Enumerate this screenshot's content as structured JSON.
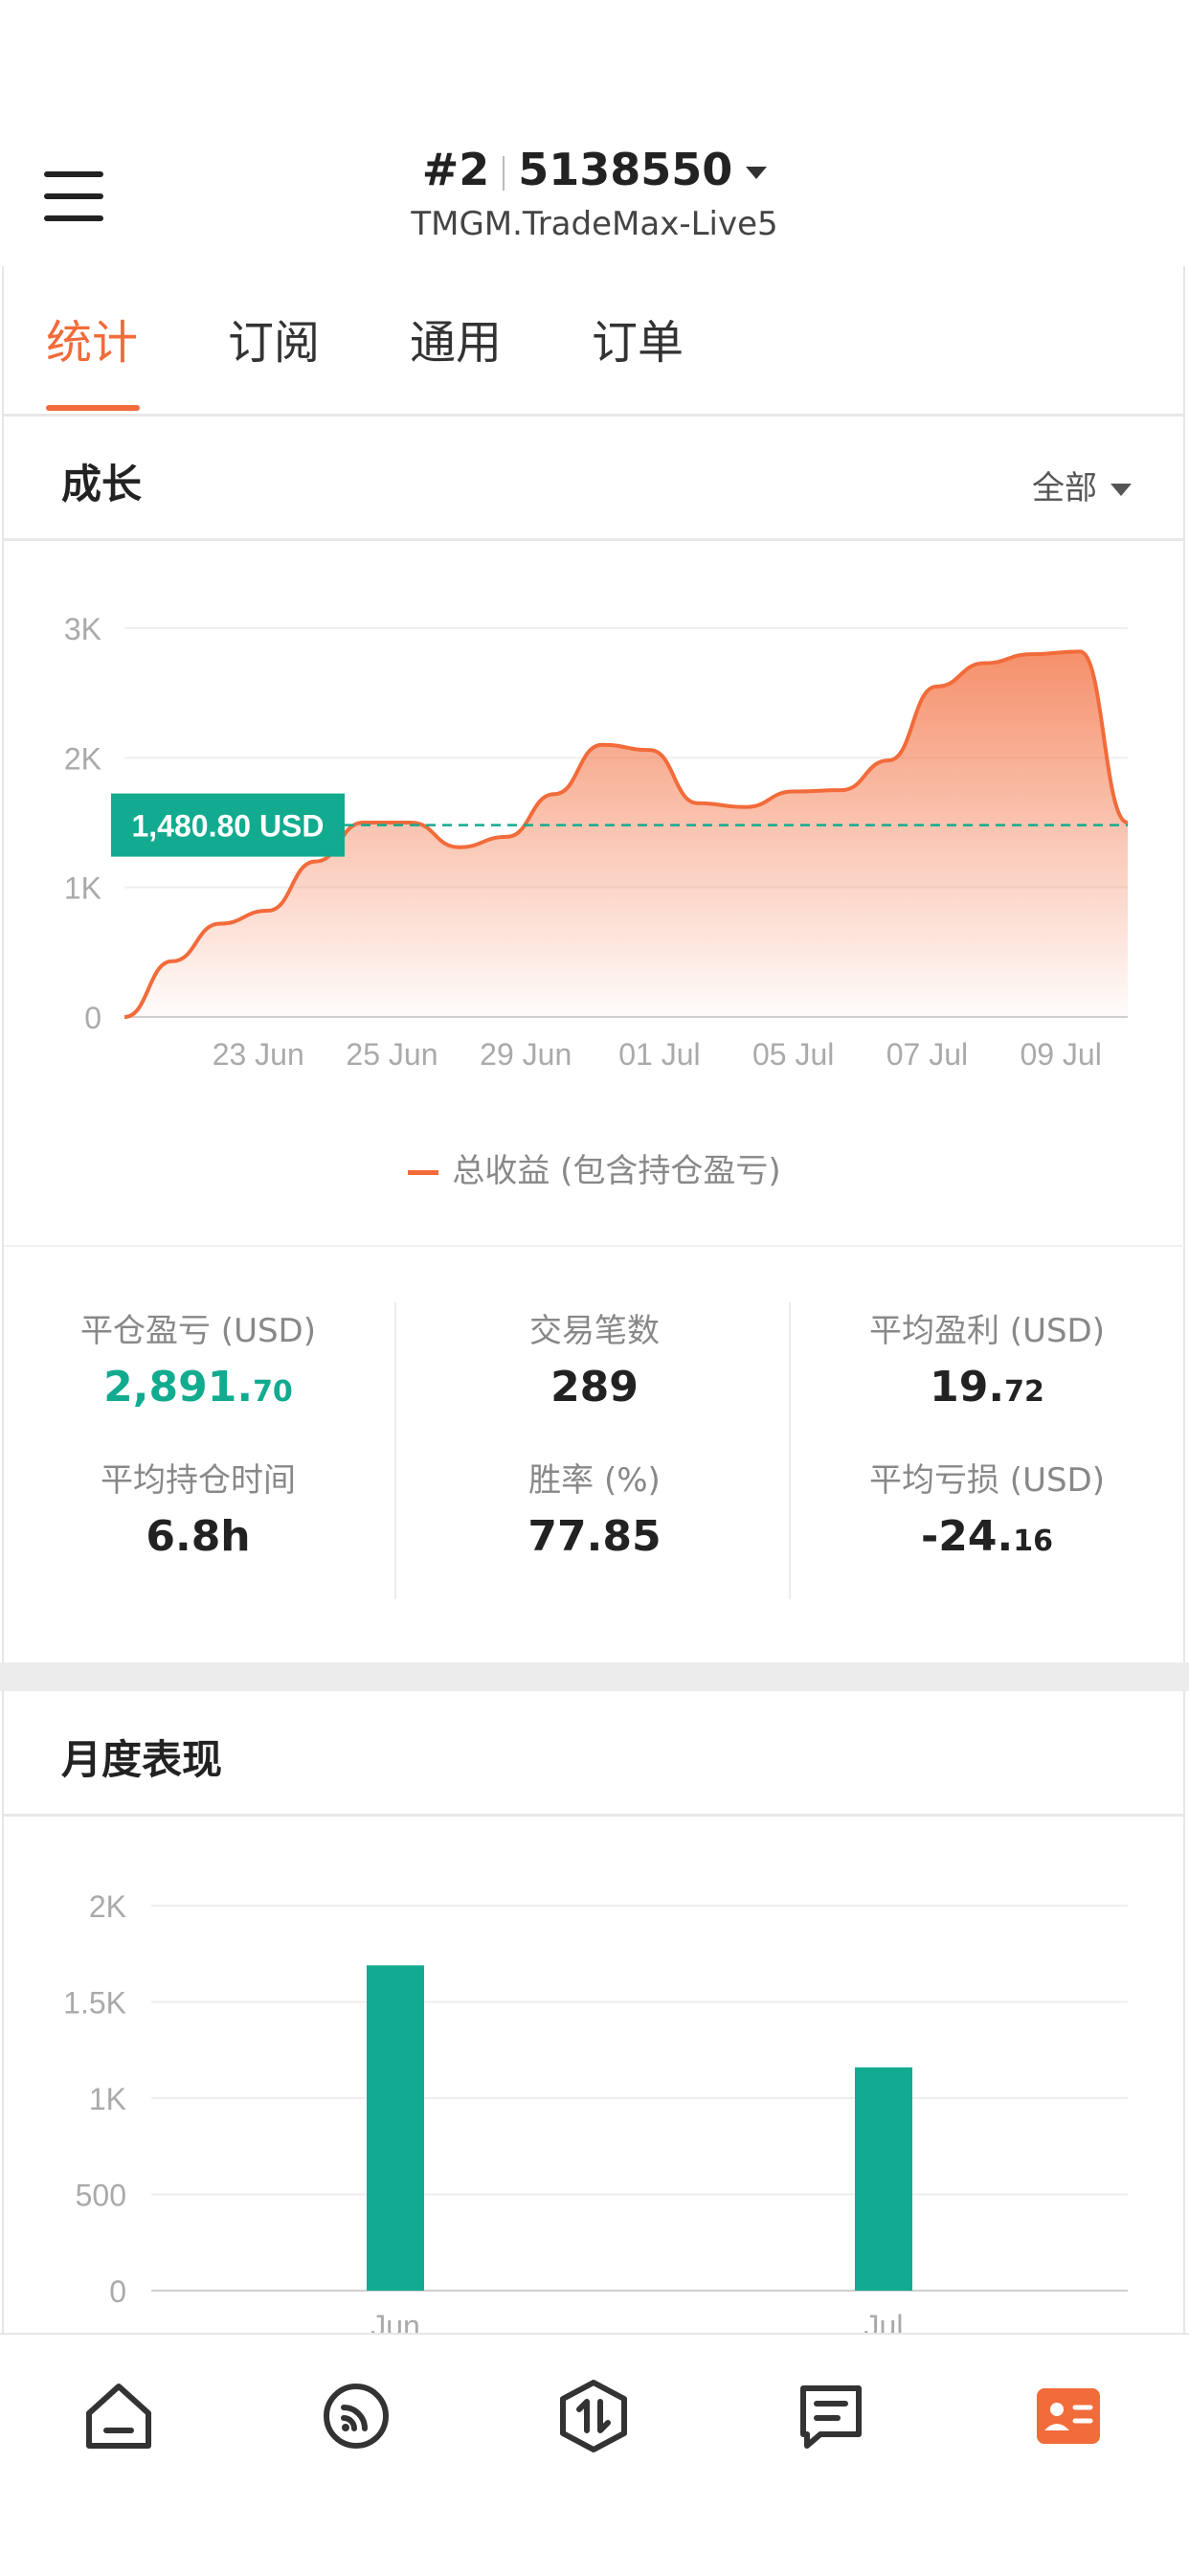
{
  "header": {
    "account_index": "#2",
    "account_number": "5138550",
    "server": "TMGM.TradeMax-Live5"
  },
  "tabs": [
    {
      "label": "统计",
      "active": true
    },
    {
      "label": "订阅",
      "active": false
    },
    {
      "label": "通用",
      "active": false
    },
    {
      "label": "订单",
      "active": false
    }
  ],
  "growth": {
    "title": "成长",
    "filter": "全部",
    "legend": "总收益 (包含持仓盈亏)"
  },
  "stats": {
    "closed_pnl": {
      "label": "平仓盈亏 (USD)",
      "int": "2,891.",
      "frac": "70"
    },
    "trades": {
      "label": "交易笔数",
      "value": "289"
    },
    "avg_profit": {
      "label": "平均盈利 (USD)",
      "int": "19.",
      "frac": "72"
    },
    "avg_hold": {
      "label": "平均持仓时间",
      "value": "6.8h"
    },
    "win_rate": {
      "label": "胜率 (%)",
      "value": "77.85"
    },
    "avg_loss": {
      "label": "平均亏损 (USD)",
      "int": "-24.",
      "frac": "16"
    }
  },
  "monthly": {
    "title": "月度表现"
  },
  "colors": {
    "accent": "#f26b3a",
    "green": "#12ab8f",
    "text": "#222222",
    "muted": "#888888"
  },
  "chart_data": [
    {
      "type": "area",
      "title": "",
      "x_ticks": [
        "23 Jun",
        "25 Jun",
        "29 Jun",
        "01 Jul",
        "05 Jul",
        "07 Jul",
        "09 Jul"
      ],
      "y_ticks": [
        "0",
        "1K",
        "2K",
        "3K"
      ],
      "ylim": [
        0,
        3000
      ],
      "grid": true,
      "legend_position": "bottom-center",
      "series": [
        {
          "name": "总收益 (包含持仓盈亏)",
          "color": "#f26b3a",
          "values": [
            0,
            430,
            720,
            820,
            1200,
            1500,
            1500,
            1310,
            1390,
            1720,
            2100,
            2060,
            1650,
            1620,
            1740,
            1750,
            1980,
            2550,
            2730,
            2800,
            2820,
            1500
          ]
        }
      ],
      "reference_line": {
        "value": 1480.8,
        "label": "1,480.80 USD",
        "color": "#12ab8f"
      }
    },
    {
      "type": "bar",
      "title": "",
      "categories": [
        "Jun",
        "Jul"
      ],
      "values": [
        1690,
        1160
      ],
      "y_ticks": [
        "0",
        "500",
        "1K",
        "1.5K",
        "2K"
      ],
      "ylim": [
        0,
        2000
      ],
      "color": "#12ab8f"
    }
  ]
}
